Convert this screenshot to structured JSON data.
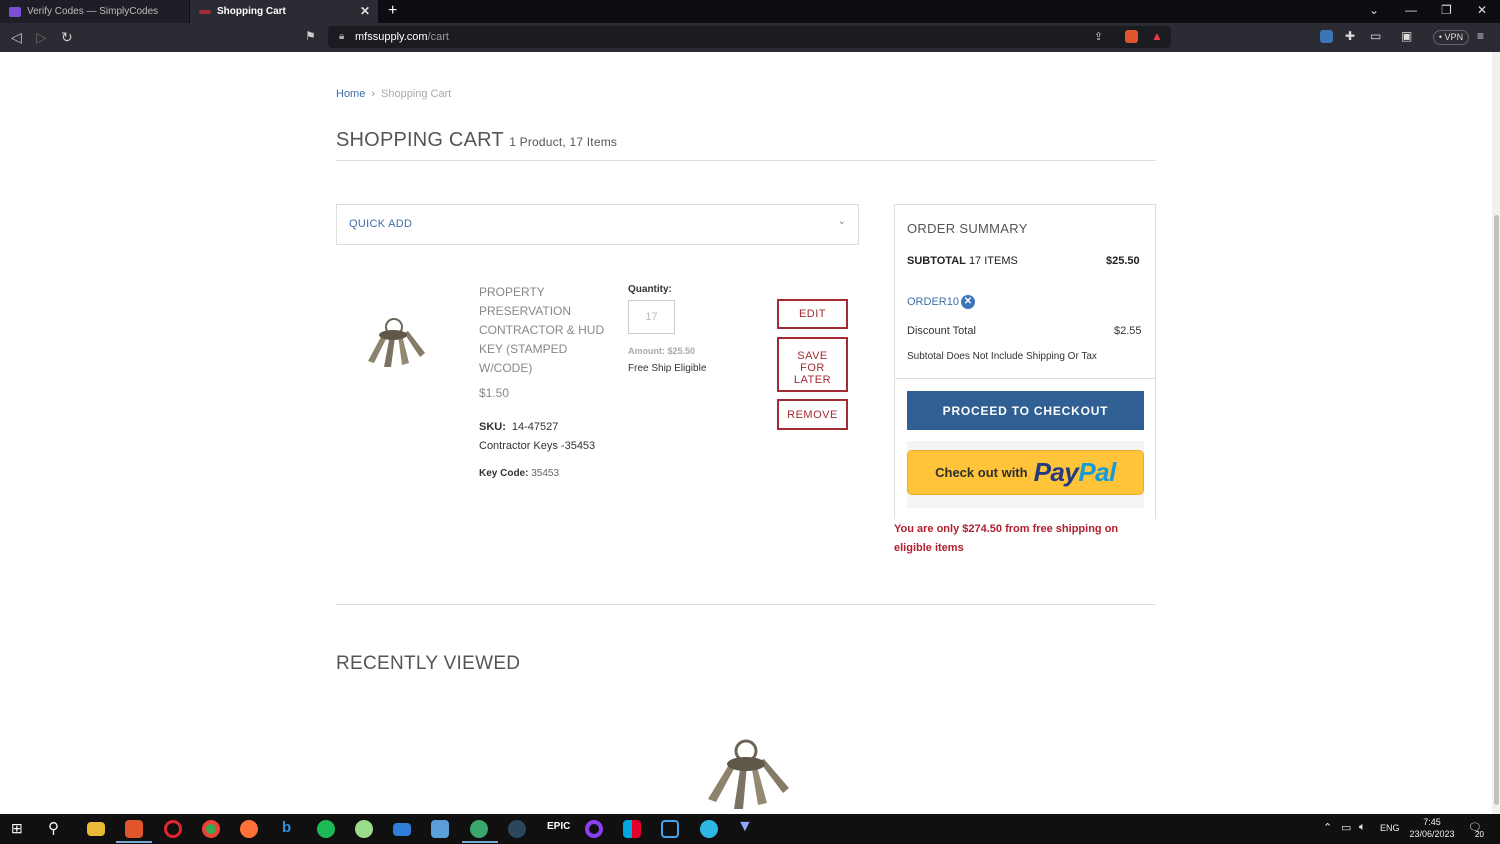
{
  "browser": {
    "tabs": [
      {
        "title": "Verify Codes — SimplyCodes",
        "active": false
      },
      {
        "title": "Shopping Cart",
        "active": true
      }
    ],
    "url_domain": "mfssupply.com",
    "url_path": "/cart",
    "vpn_label": "• VPN",
    "colors": {
      "accent": "#2f5f93",
      "danger": "#a32b34"
    }
  },
  "breadcrumb": {
    "home": "Home",
    "sep": "›",
    "current": "Shopping Cart"
  },
  "page": {
    "title": "SHOPPING CART",
    "title_sub": "1 Product, 17 Items"
  },
  "quick_add": {
    "label": "QUICK ADD"
  },
  "cart_item": {
    "name_lines": [
      "PROPERTY",
      "PRESERVATION",
      "CONTRACTOR & HUD",
      "KEY (STAMPED",
      "W/CODE)"
    ],
    "price": "$1.50",
    "sku_label": "SKU:",
    "sku_value": "14-47527",
    "category": "Contractor Keys -35453",
    "keycode_label": "Key Code:",
    "keycode_value": "35453",
    "quantity_label": "Quantity:",
    "quantity_value": "17",
    "amount": "Amount: $25.50",
    "free_ship": "Free Ship Eligible",
    "edit_label": "EDIT",
    "save_label_lines": [
      "SAVE",
      "FOR",
      "LATER"
    ],
    "remove_label": "REMOVE"
  },
  "summary": {
    "title": "ORDER SUMMARY",
    "subtotal_label": "SUBTOTAL",
    "subtotal_items": "17 ITEMS",
    "subtotal_value": "$25.50",
    "coupon_code": "ORDER10",
    "discount_label": "Discount Total",
    "discount_value": "$2.55",
    "note": "Subtotal Does Not Include Shipping Or Tax",
    "checkout_label": "PROCEED TO CHECKOUT",
    "paypal_prefix": "Check out with",
    "paypal_logo_1": "Pay",
    "paypal_logo_2": "Pal",
    "free_ship_msg": "You are only $274.50 from free shipping on eligible items"
  },
  "recent": {
    "title": "RECENTLY VIEWED"
  },
  "taskbar": {
    "lang": "ENG",
    "time": "7:45",
    "date": "23/06/2023",
    "notif_count": "20"
  }
}
